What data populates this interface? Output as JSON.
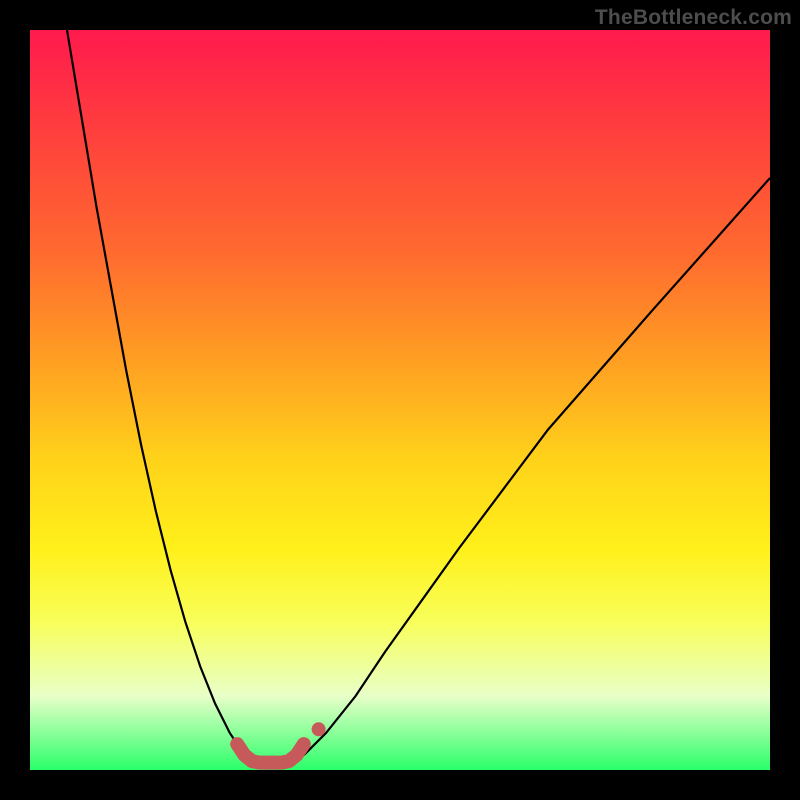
{
  "watermark": "TheBottleneck.com",
  "chart_data": {
    "type": "line",
    "title": "",
    "xlabel": "",
    "ylabel": "",
    "xlim": [
      0,
      100
    ],
    "ylim": [
      0,
      100
    ],
    "grid": false,
    "legend": false,
    "note": "No axes or tick labels are shown. Values are estimated percentages of the plot area.",
    "series": [
      {
        "name": "left-curve",
        "color": "#000000",
        "x": [
          5,
          7,
          9,
          11,
          13,
          15,
          17,
          19,
          21,
          23,
          25,
          27,
          29
        ],
        "y": [
          100,
          88,
          76,
          65,
          54,
          44,
          35,
          27,
          20,
          14,
          9,
          5,
          2
        ]
      },
      {
        "name": "right-curve",
        "color": "#000000",
        "x": [
          37,
          40,
          44,
          48,
          53,
          58,
          64,
          70,
          77,
          84,
          92,
          100
        ],
        "y": [
          2,
          5,
          10,
          16,
          23,
          30,
          38,
          46,
          54,
          62,
          71,
          80
        ]
      },
      {
        "name": "trough-marker",
        "color": "#c65a5a",
        "x": [
          28,
          29,
          30,
          31,
          32,
          33,
          34,
          35,
          36,
          37
        ],
        "y": [
          3.5,
          2.0,
          1.2,
          1.0,
          1.0,
          1.0,
          1.0,
          1.2,
          2.0,
          3.5
        ]
      },
      {
        "name": "trough-end-dot",
        "color": "#c65a5a",
        "x": [
          39
        ],
        "y": [
          5.5
        ]
      }
    ]
  }
}
